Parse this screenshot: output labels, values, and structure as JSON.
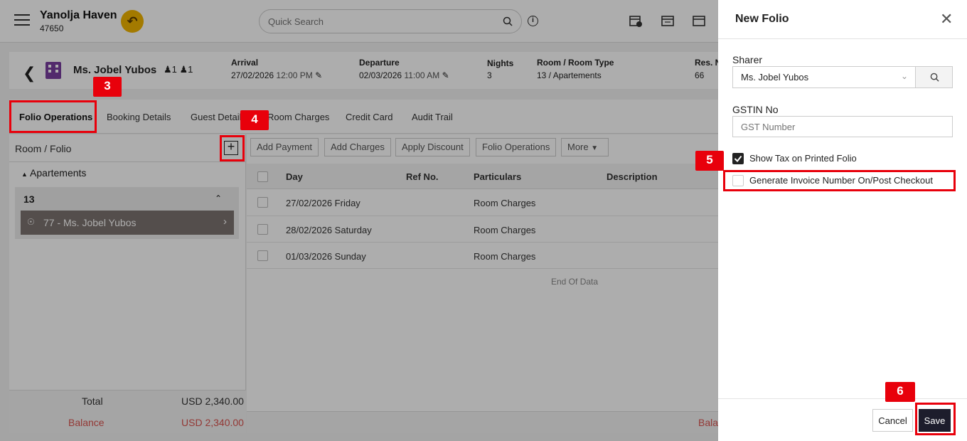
{
  "header": {
    "hotel_name": "Yanolja Haven",
    "hotel_code": "47650",
    "search_placeholder": "Quick Search"
  },
  "guest": {
    "name": "Ms. Jobel Yubos",
    "adults": "1",
    "children": "1",
    "arrival_label": "Arrival",
    "arrival_date": "27/02/2026",
    "arrival_time": "12:00 PM",
    "departure_label": "Departure",
    "departure_date": "02/03/2026",
    "departure_time": "11:00 AM",
    "nights_label": "Nights",
    "nights_value": "3",
    "room_label": "Room / Room Type",
    "room_value": "13 / Apartements",
    "res_label": "Res. N",
    "res_value": "66"
  },
  "tabs": [
    "Folio Operations",
    "Booking Details",
    "Guest Details",
    "Room Charges",
    "Credit Card",
    "Audit Trail"
  ],
  "left": {
    "title": "Room / Folio",
    "group": "Apartements",
    "room": "13",
    "folio": "77 - Ms. Jobel Yubos",
    "total_label": "Total",
    "total_value": "USD 2,340.00",
    "balance_label": "Balance",
    "balance_value": "USD 2,340.00"
  },
  "actions": [
    "Add Payment",
    "Add Charges",
    "Apply Discount",
    "Folio Operations",
    "More"
  ],
  "grid": {
    "headers": [
      "Day",
      "Ref No.",
      "Particulars",
      "Description"
    ],
    "rows": [
      {
        "day": "27/02/2026 Friday",
        "particulars": "Room Charges"
      },
      {
        "day": "28/02/2026 Saturday",
        "particulars": "Room Charges"
      },
      {
        "day": "01/03/2026 Sunday",
        "particulars": "Room Charges"
      }
    ],
    "end_text": "End Of Data",
    "footer_balance": "Bala"
  },
  "drawer": {
    "title": "New Folio",
    "sharer_label": "Sharer",
    "sharer_value": "Ms. Jobel Yubos",
    "gstin_label": "GSTIN No",
    "gstin_placeholder": "GST Number",
    "show_tax_label": "Show Tax on Printed Folio",
    "show_tax_checked": true,
    "gen_invoice_label": "Generate Invoice Number On/Post Checkout",
    "gen_invoice_checked": false,
    "cancel_label": "Cancel",
    "save_label": "Save"
  },
  "markers": [
    "3",
    "4",
    "5",
    "6"
  ],
  "colors": {
    "accent_dark": "#1d1d2c",
    "callout_red": "#e8000b",
    "balance_red": "#d9534f",
    "undo_yellow": "#f0b400",
    "folio_row": "#7d7370"
  },
  "icons": [
    "menu-icon",
    "undo-icon",
    "search-icon",
    "info-icon",
    "calendar-add-icon",
    "calendar-ev-icon",
    "calendar-icon",
    "back-icon",
    "building-icon",
    "adult-icon",
    "child-icon",
    "edit-icon",
    "plus-icon",
    "caret-up-icon",
    "chevron-up-icon",
    "share-icon",
    "chevron-right-icon",
    "dropdown-icon",
    "close-icon",
    "checkmark-icon"
  ]
}
